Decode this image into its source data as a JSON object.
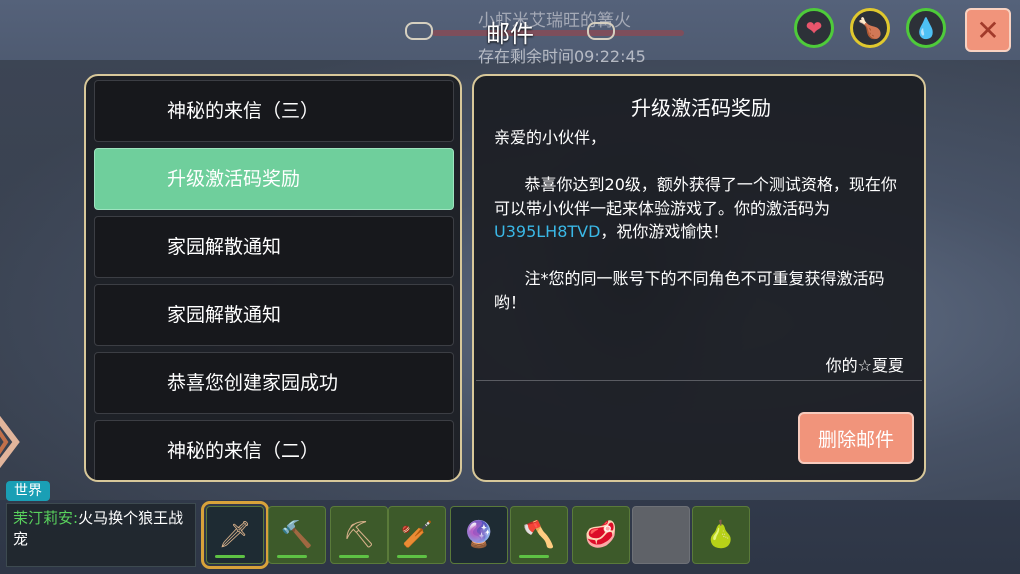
{
  "background": {
    "player_name": "小虾米艾瑞旺的篝火"
  },
  "header": {
    "title": "邮件",
    "timer_text": "存在剩余时间09:22:45"
  },
  "status_icons": [
    {
      "name": "heart-icon",
      "glyph": "❤",
      "color": "#e9556c"
    },
    {
      "name": "food-icon",
      "glyph": "🍗",
      "color": "#e0c82e"
    },
    {
      "name": "water-drop-icon",
      "glyph": "💧",
      "color": "#33c5c9"
    }
  ],
  "close_button": {
    "glyph": "✕"
  },
  "mail_list": [
    {
      "label": "神秘的来信（三）",
      "selected": false
    },
    {
      "label": "升级激活码奖励",
      "selected": true
    },
    {
      "label": "家园解散通知",
      "selected": false
    },
    {
      "label": "家园解散通知",
      "selected": false
    },
    {
      "label": "恭喜您创建家园成功",
      "selected": false
    },
    {
      "label": "神秘的来信（二）",
      "selected": false
    }
  ],
  "mail_detail": {
    "title": "升级激活码奖励",
    "greeting": "亲爱的小伙伴，",
    "para1": "恭喜你达到20级，额外获得了一个测试资格，现在你可以带小伙伴一起来体验游戏了。你的激活码为",
    "code": "U395LH8TVD",
    "para1_end": "，祝你游戏愉快！",
    "para2": "注*您的同一账号下的不同角色不可重复获得激活码哟！",
    "signature": "你的☆夏夏",
    "delete_label": "删除邮件"
  },
  "chat": {
    "tab_label": "世界",
    "sender": "茉汀莉安",
    "separator": ":",
    "message": "火马换个狼王战宠"
  },
  "hotbar": [
    {
      "name": "machete-icon",
      "glyph": "🗡",
      "empty": false,
      "selected": true
    },
    {
      "name": "wooden-hammer-icon",
      "glyph": "🔨",
      "empty": false,
      "selected": false
    },
    {
      "name": "pickaxe-icon",
      "glyph": "⛏",
      "empty": false,
      "selected": false
    },
    {
      "name": "spiked-club-icon",
      "glyph": "🏏",
      "empty": false,
      "selected": false
    },
    {
      "name": "dark-orb-icon",
      "glyph": "🔮",
      "empty": false,
      "selected": false
    },
    {
      "name": "stone-axe-icon",
      "glyph": "🪓",
      "empty": false,
      "selected": false
    },
    {
      "name": "meat-icon",
      "glyph": "🥩",
      "empty": false,
      "selected": false
    },
    {
      "name": "empty-slot-icon",
      "glyph": "",
      "empty": true,
      "selected": false
    },
    {
      "name": "gourd-icon",
      "glyph": "🍐",
      "empty": false,
      "selected": false
    }
  ]
}
